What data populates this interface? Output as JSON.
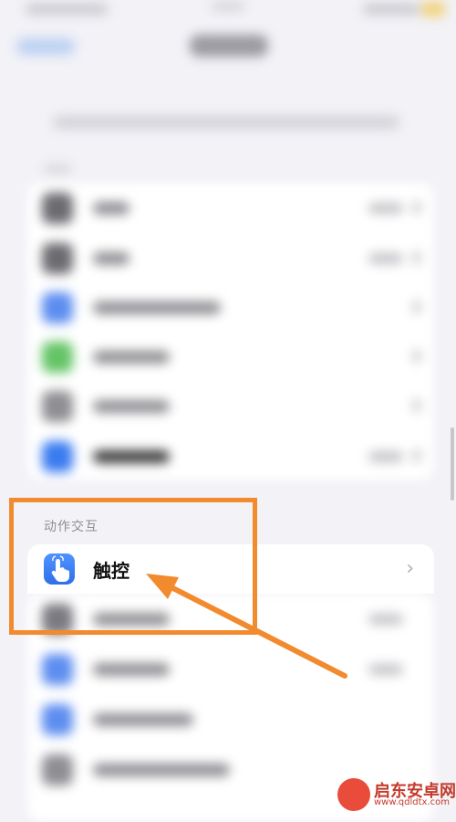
{
  "section_header": "动作交互",
  "touch_item": {
    "label": "触控",
    "icon": "hand-tap-icon",
    "chevron": "›"
  },
  "blurred_rows": [
    {
      "icon_color": "#6b6b70",
      "label_width": 40
    },
    {
      "icon_color": "#6b6b70",
      "label_width": 40
    },
    {
      "icon_color": "#5d8df0",
      "label_width": 140
    },
    {
      "icon_color": "#64c466",
      "label_width": 84
    },
    {
      "icon_color": "#8e8e93",
      "label_width": 84
    },
    {
      "icon_color": "#3a7bf0",
      "label_width": 84
    }
  ],
  "colors": {
    "accent_blue": "#2f6fe8",
    "annotation_orange": "#f28a2e",
    "background": "#f2f2f7"
  },
  "watermark": {
    "brand": "启东安卓网",
    "url": "www.qdldtx.com"
  }
}
